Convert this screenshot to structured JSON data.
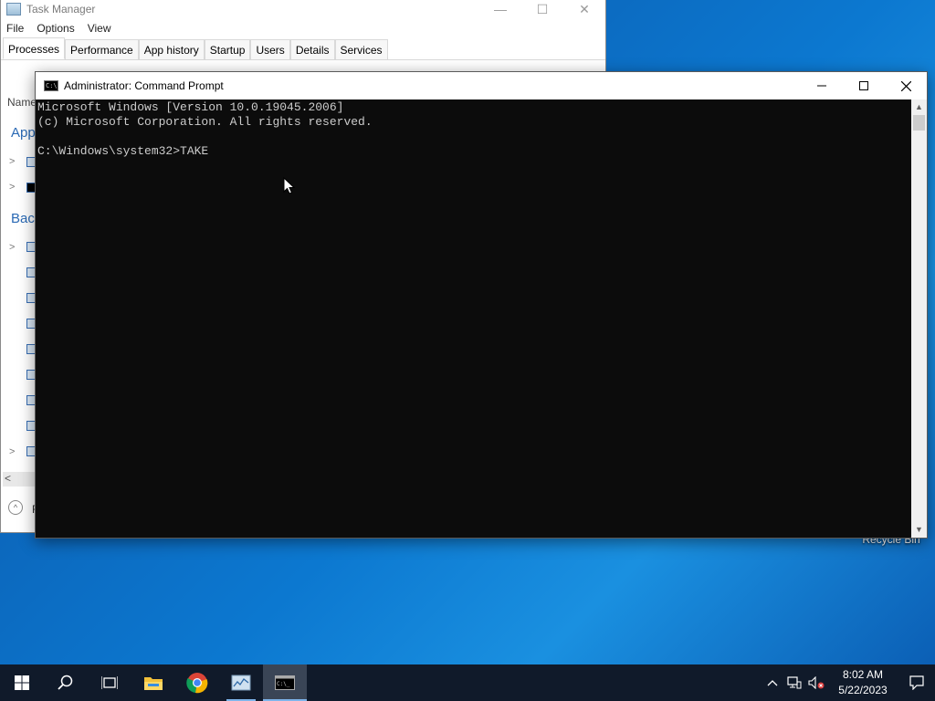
{
  "task_manager": {
    "title": "Task Manager",
    "window_controls": [
      "—",
      "☐",
      "✕"
    ],
    "menu": [
      "File",
      "Options",
      "View"
    ],
    "tabs": [
      "Processes",
      "Performance",
      "App history",
      "Startup",
      "Users",
      "Details",
      "Services"
    ],
    "active_tab": "Processes",
    "column_name": "Name",
    "group_apps": "App",
    "group_background": "Back",
    "footer_text": "F"
  },
  "cmd": {
    "title": "Administrator: Command Prompt",
    "lines": [
      "Microsoft Windows [Version 10.0.19045.2006]",
      "(c) Microsoft Corporation. All rights reserved.",
      "",
      "C:\\Windows\\system32>TAKE"
    ]
  },
  "desktop": {
    "recycle_bin_label": "Recycle Bin"
  },
  "taskbar": {
    "items": [
      "start-icon",
      "search-icon",
      "task-view-icon",
      "file-explorer-icon",
      "chrome-icon",
      "task-manager-icon",
      "command-prompt-icon"
    ],
    "clock_time": "8:02 AM",
    "clock_date": "5/22/2023"
  },
  "colors": {
    "taskbar": "#101a2a",
    "console_bg": "#0c0c0c",
    "console_text": "#cccccc",
    "accent": "#0c78d0"
  }
}
